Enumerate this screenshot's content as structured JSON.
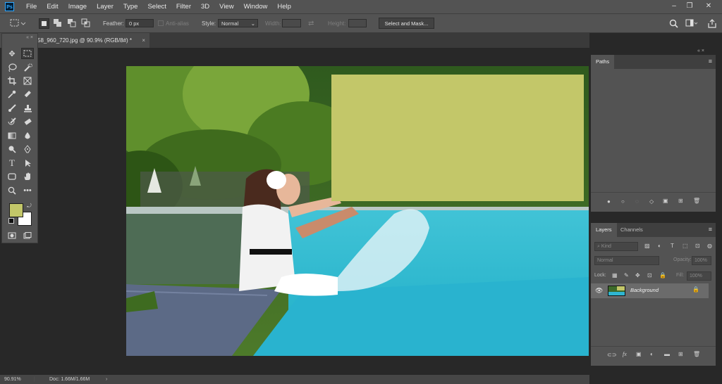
{
  "app": {
    "logo": "Ps"
  },
  "menu": [
    "File",
    "Edit",
    "Image",
    "Layer",
    "Type",
    "Select",
    "Filter",
    "3D",
    "View",
    "Window",
    "Help"
  ],
  "window_controls": {
    "minimize": "–",
    "restore": "❐",
    "close": "✕"
  },
  "options_bar": {
    "feather_label": "Feather:",
    "feather_value": "0 px",
    "anti_alias_label": "Anti-alias",
    "style_label": "Style:",
    "style_value": "Normal",
    "width_label": "Width:",
    "height_label": "Height:",
    "select_mask_label": "Select and Mask..."
  },
  "document_tab": {
    "title": "58_960_720.jpg @ 90.9% (RGB/8#) *",
    "close": "×"
  },
  "status_bar": {
    "zoom": "90.91%",
    "doc_info": "Doc: 1.66M/1.66M"
  },
  "colors": {
    "foreground": "#c3c769",
    "background": "#ffffff",
    "overlay_rect": "#c3c769"
  },
  "paths_panel": {
    "tab": "Paths"
  },
  "layers_panel": {
    "tabs": [
      "Layers",
      "Channels"
    ],
    "kind_placeholder": "Kind",
    "blend_mode": "Normal",
    "opacity_label": "Opacity:",
    "opacity_value": "100%",
    "lock_label": "Lock:",
    "fill_label": "Fill:",
    "fill_value": "100%",
    "layers": [
      {
        "name": "Background",
        "locked": true,
        "visible": true
      }
    ]
  },
  "tools": [
    "move-tool",
    "rectangular-marquee-tool",
    "lasso-tool",
    "quick-selection-tool",
    "crop-tool",
    "frame-tool",
    "eyedropper-tool",
    "healing-brush-tool",
    "brush-tool",
    "clone-stamp-tool",
    "history-brush-tool",
    "eraser-tool",
    "gradient-tool",
    "blur-tool",
    "dodge-tool",
    "pen-tool",
    "type-tool",
    "path-selection-tool",
    "rectangle-tool",
    "hand-tool",
    "zoom-tool",
    "more-tools"
  ]
}
